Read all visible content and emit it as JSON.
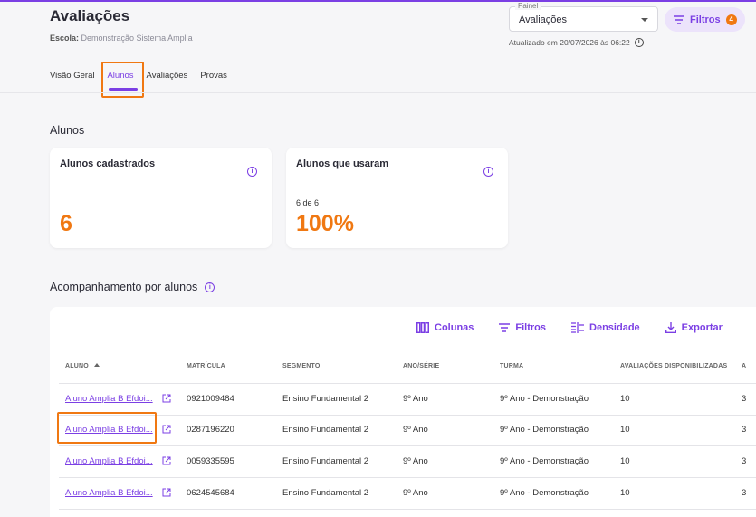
{
  "header": {
    "title": "Avaliações",
    "school_label": "Escola:",
    "school_value": "Demonstração Sistema Amplia",
    "panel_label": "Painel",
    "panel_value": "Avaliações",
    "filters_label": "Filtros",
    "filters_count": "4",
    "updated_text": "Atualizado em 20/07/2026 às 06:22"
  },
  "tabs": [
    {
      "label": "Visão Geral"
    },
    {
      "label": "Alunos"
    },
    {
      "label": "Avaliações"
    },
    {
      "label": "Provas"
    }
  ],
  "section_alunos": {
    "title": "Alunos",
    "card1": {
      "title": "Alunos cadastrados",
      "value": "6"
    },
    "card2": {
      "title": "Alunos que usaram",
      "sub": "6 de 6",
      "value": "100%"
    }
  },
  "tracking": {
    "title": "Acompanhamento por alunos",
    "toolbar": {
      "columns": "Colunas",
      "filters": "Filtros",
      "density": "Densidade",
      "export": "Exportar"
    },
    "headers": [
      "ALUNO",
      "MATRÍCULA",
      "SEGMENTO",
      "ANO/SÉRIE",
      "TURMA",
      "AVALIAÇÕES DISPONIBILIZADAS",
      "A"
    ],
    "rows": [
      {
        "aluno": "Aluno Amplia B Efdoi...",
        "matricula": "0921009484",
        "segmento": "Ensino Fundamental 2",
        "ano": "9º Ano",
        "turma": "9º Ano - Demonstração",
        "avaliacoes": "10",
        "extra": "3"
      },
      {
        "aluno": "Aluno Amplia B Efdoi...",
        "matricula": "0287196220",
        "segmento": "Ensino Fundamental 2",
        "ano": "9º Ano",
        "turma": "9º Ano - Demonstração",
        "avaliacoes": "10",
        "extra": "3"
      },
      {
        "aluno": "Aluno Amplia B Efdoi...",
        "matricula": "0059335595",
        "segmento": "Ensino Fundamental 2",
        "ano": "9º Ano",
        "turma": "9º Ano - Demonstração",
        "avaliacoes": "10",
        "extra": "3"
      },
      {
        "aluno": "Aluno Amplia B Efdoi...",
        "matricula": "0624545684",
        "segmento": "Ensino Fundamental 2",
        "ano": "9º Ano",
        "turma": "9º Ano - Demonstração",
        "avaliacoes": "10",
        "extra": "3"
      }
    ]
  },
  "colors": {
    "accent": "#7b3fe4",
    "highlight": "#f07812"
  }
}
